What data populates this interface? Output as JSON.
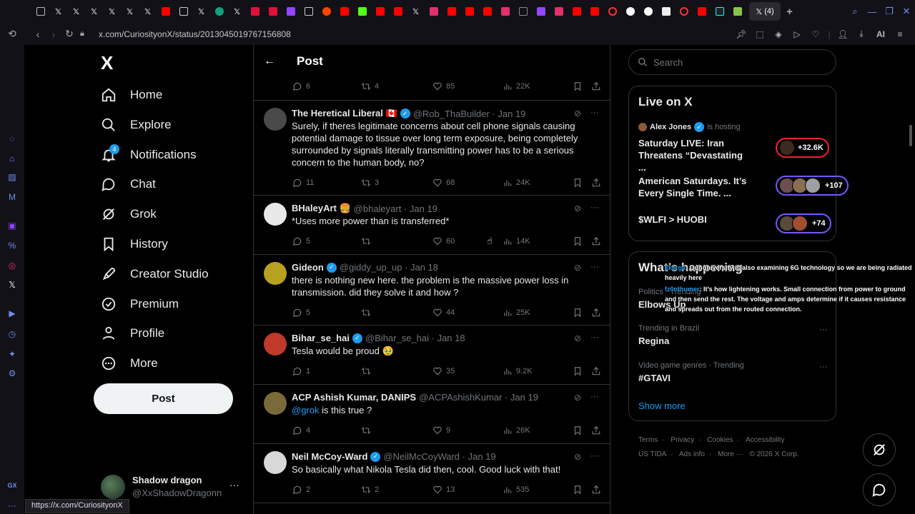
{
  "browser": {
    "tab_count_label": "(4)",
    "url": "x.com/CuriosityonX/status/2013045019767156808",
    "ai_label": "AI",
    "status_url": "https://x.com/CuriosityonX",
    "side_label": "GX"
  },
  "nav": {
    "logo": "X",
    "items": [
      {
        "label": "Home",
        "icon": "home-icon"
      },
      {
        "label": "Explore",
        "icon": "search-icon"
      },
      {
        "label": "Notifications",
        "icon": "bell-icon",
        "badge": "4"
      },
      {
        "label": "Chat",
        "icon": "chat-icon"
      },
      {
        "label": "Grok",
        "icon": "grok-icon"
      },
      {
        "label": "History",
        "icon": "bookmark-icon"
      },
      {
        "label": "Creator Studio",
        "icon": "rocket-icon"
      },
      {
        "label": "Premium",
        "icon": "premium-icon"
      },
      {
        "label": "Profile",
        "icon": "person-icon"
      },
      {
        "label": "More",
        "icon": "more-circle-icon"
      }
    ],
    "post_button": "Post",
    "account": {
      "name": "Shadow dragon",
      "handle": "@XxShadowDragonn"
    }
  },
  "header": {
    "title": "Post"
  },
  "top_actions": {
    "replies": "6",
    "reposts": "4",
    "likes": "85",
    "views": "22K"
  },
  "tweets": [
    {
      "name": "The Heretical Liberal 🇨🇦",
      "verified": true,
      "handle": "@Rob_ThaBuilder",
      "date": "· Jan 19",
      "text": "Surely, if theres legitimate concerns about cell phone signals causing potential damage to tissue over long term exposure, being completely surrounded by signals literally transmitting power has to be a serious concern to the human body, no?",
      "replies": "11",
      "reposts": "3",
      "likes": "68",
      "views": "24K",
      "avatar_color": "#4a4a4a"
    },
    {
      "name": "BHaleyArt 🍔",
      "verified": false,
      "handle": "@bhaleyart",
      "date": "· Jan 19",
      "text": "*Uses more power than is transferred*",
      "replies": "5",
      "reposts": "",
      "likes": "60",
      "views": "14K",
      "avatar_color": "#e8e8e8"
    },
    {
      "name": "Gideon",
      "verified": true,
      "handle": "@giddy_up_up",
      "date": "· Jan 18",
      "text": "there is nothing new here. the problem is the massive power loss in transmission. did they solve it and how ?",
      "replies": "5",
      "reposts": "",
      "likes": "44",
      "views": "25K",
      "avatar_color": "#b8a020"
    },
    {
      "name": "Bihar_se_hai",
      "verified": true,
      "handle": "@Bihar_se_hai",
      "date": "· Jan 18",
      "text": "Tesla would be proud 🥹",
      "replies": "1",
      "reposts": "",
      "likes": "35",
      "views": "9.2K",
      "avatar_color": "#c0392b"
    },
    {
      "name": "ACP Ashish Kumar, DANIPS",
      "verified": false,
      "handle": "@ACPAshishKumar",
      "date": "· Jan 19",
      "mention": "@grok",
      "text": " is this true ?",
      "replies": "4",
      "reposts": "",
      "likes": "9",
      "views": "26K",
      "avatar_color": "#7a6a3a"
    },
    {
      "name": "Neil McCoy-Ward",
      "verified": true,
      "handle": "@NeilMcCoyWard",
      "date": "· Jan 19",
      "text": "So basically what Nikola Tesla did then, cool. Good luck with that!",
      "replies": "2",
      "reposts": "2",
      "likes": "13",
      "views": "535",
      "avatar_color": "#d8d8d8"
    }
  ],
  "right": {
    "search_placeholder": "Search",
    "live_title": "Live on X",
    "live_host": {
      "name": "Alex Jones",
      "suffix": "is hosting"
    },
    "live_items": [
      {
        "title": "Saturday LIVE: Iran Threatens “Devastating ...",
        "count": "+32.6K",
        "color": "#f4212e"
      },
      {
        "title": "American Saturdays. It’s Every Single Time. ...",
        "count": "+107",
        "color": "#7856ff"
      },
      {
        "title": "$WLFI > HUOBI",
        "count": "+74",
        "color": "#7856ff"
      }
    ],
    "happening_title": "What’s happening",
    "trends": [
      {
        "category": "Politics · Trending",
        "name": "Elbows Up"
      },
      {
        "category": "Trending in Brazil",
        "name": "Regina"
      },
      {
        "category": "Video game genres · Trending",
        "name": "#GTAVI"
      }
    ],
    "show_more": "Show more",
    "footer": [
      "Terms",
      "Privacy",
      "Cookies",
      "Accessibility",
      "US TIDA",
      "Ads info",
      "More ···",
      "© 2026 X Corp."
    ]
  },
  "overlay": [
    {
      "user": "kkerga",
      "text": ": Our university is also examining 6G technology so we are being radiated heavily here"
    },
    {
      "user": "fz0nthumer",
      "text": ": It's how lightening works. Small connection from power to ground and then send the rest. The voltage and amps determine if it causes resistance and spreads out from the routed connection."
    }
  ]
}
